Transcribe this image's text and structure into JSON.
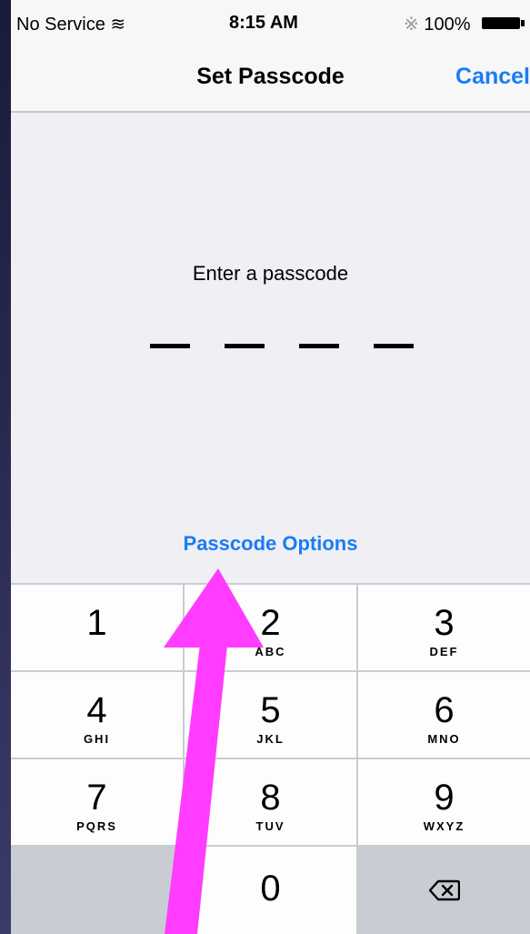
{
  "status_bar": {
    "carrier": "No Service",
    "wifi_icon": "wifi-icon",
    "time": "8:15 AM",
    "bluetooth_icon": "bluetooth-icon",
    "battery": "100%"
  },
  "nav": {
    "title": "Set Passcode",
    "cancel": "Cancel"
  },
  "passcode": {
    "prompt": "Enter a passcode",
    "digits_entered": 0,
    "digits_total": 4,
    "options_link": "Passcode Options"
  },
  "keypad": {
    "keys": [
      {
        "num": "1",
        "letters": ""
      },
      {
        "num": "2",
        "letters": "ABC"
      },
      {
        "num": "3",
        "letters": "DEF"
      },
      {
        "num": "4",
        "letters": "GHI"
      },
      {
        "num": "5",
        "letters": "JKL"
      },
      {
        "num": "6",
        "letters": "MNO"
      },
      {
        "num": "7",
        "letters": "PQRS"
      },
      {
        "num": "8",
        "letters": "TUV"
      },
      {
        "num": "9",
        "letters": "WXYZ"
      },
      {
        "num": "0",
        "letters": ""
      }
    ],
    "delete_icon": "backspace-icon"
  },
  "annotation": {
    "arrow_color": "#ff3cff"
  }
}
